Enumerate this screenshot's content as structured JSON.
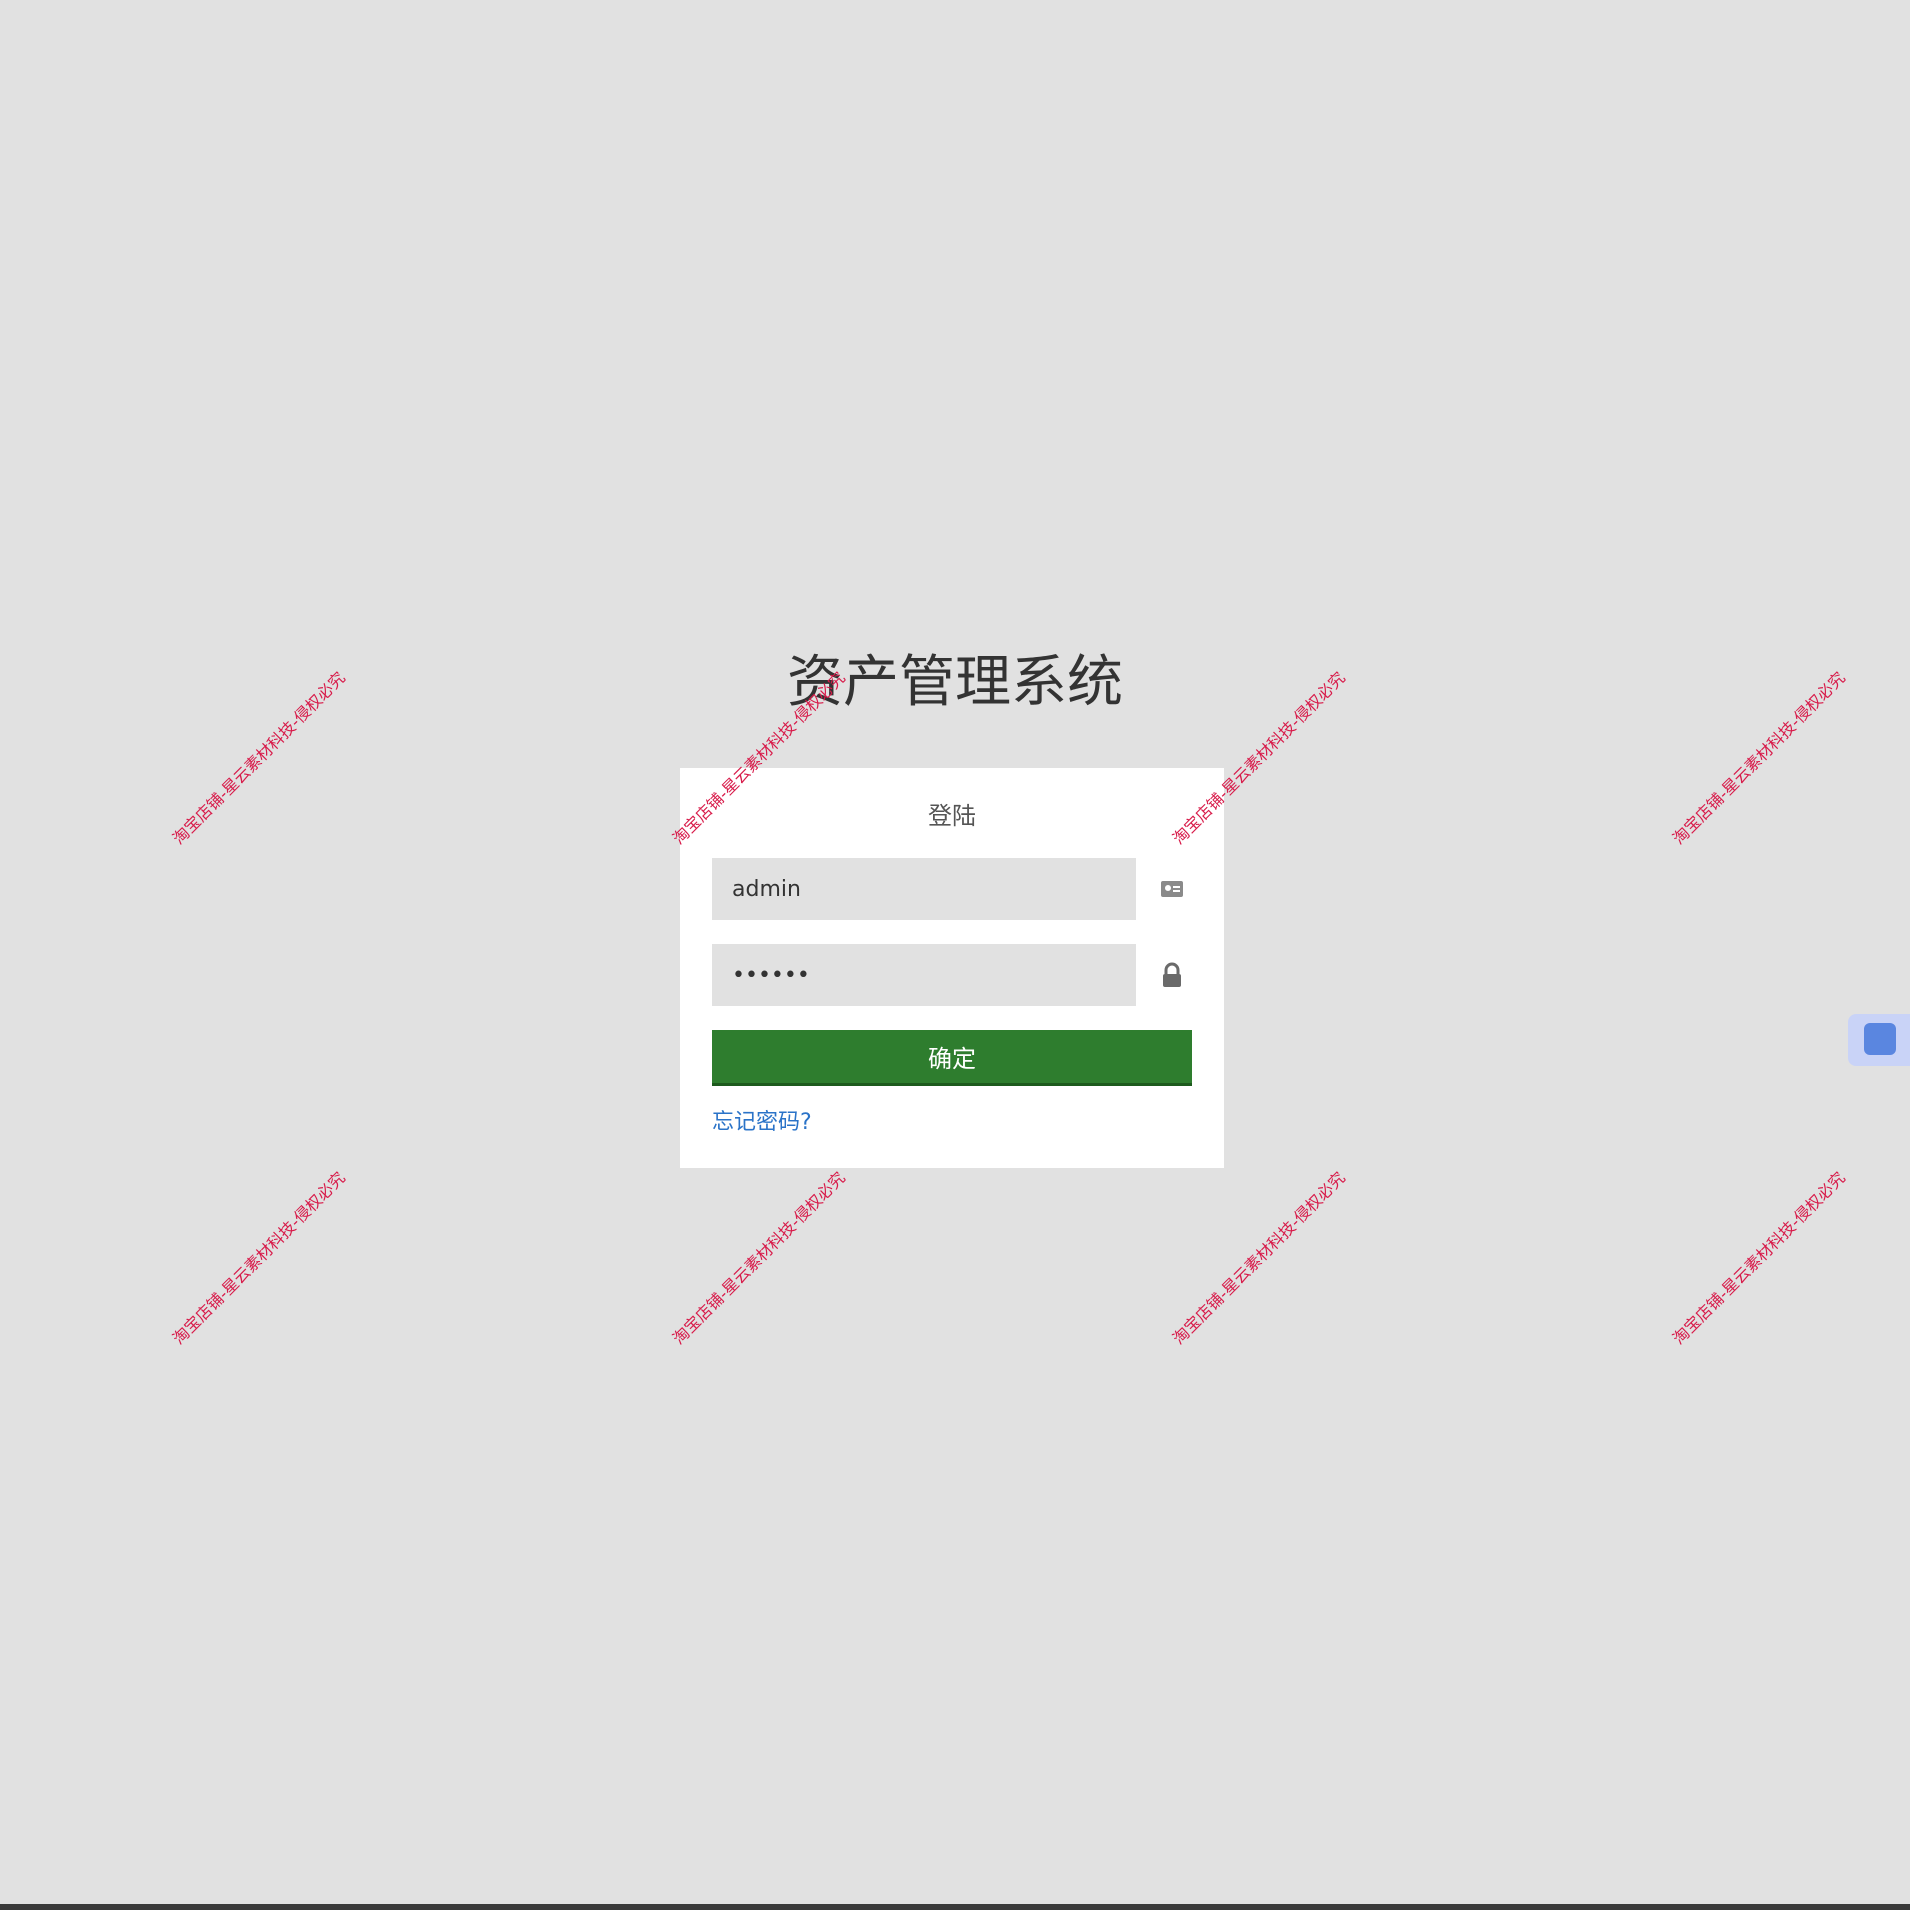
{
  "app_title": "资产管理系统",
  "login_panel": {
    "heading": "登陆",
    "username": {
      "value": "admin",
      "icon": "id-card-icon"
    },
    "password": {
      "value": "••••••",
      "icon": "lock-icon"
    },
    "submit_label": "确定",
    "forgot_password_label": "忘记密码?"
  },
  "side_widget": {
    "icon": "chat-widget-icon",
    "color": "#5a86e0"
  },
  "watermark_text": "淘宝店铺-星云素材科技-侵权必究",
  "colors": {
    "background": "#e1e1e1",
    "panel": "#ffffff",
    "primary_button": "#2e7d2e",
    "link": "#2a73c8",
    "watermark": "#d81b4a"
  }
}
